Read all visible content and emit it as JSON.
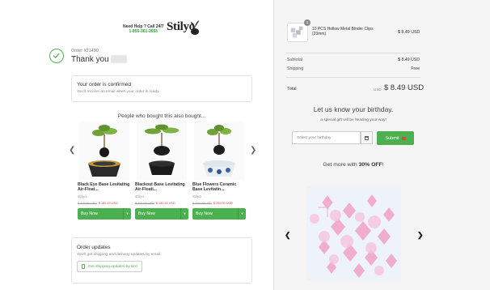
{
  "header": {
    "help_text": "Need Help ? Call 24/7",
    "phone": "1-855-361-2655",
    "logo": "Stilyo"
  },
  "order": {
    "number": "Order #21490",
    "thanks": "Thank you"
  },
  "confirmed": {
    "title": "Your order is confirmed",
    "subtitle": "You'll receive an email when your order is ready."
  },
  "upsell": {
    "title": "People who bought this also bought...",
    "products": [
      {
        "name": "Black Eye Base Levitating Air-Float...",
        "brand": "stilyo",
        "old_price": "$ 209.00 USD",
        "price": "$ 180.49 USD",
        "buy": "Buy Now"
      },
      {
        "name": "Blackout Base Levitating Air-Floati...",
        "brand": "stilyo",
        "old_price": "$ 209.00 USD",
        "price": "$ 180.49 USD",
        "buy": "Buy Now"
      },
      {
        "name": "Blue Flowers Ceramic Base Levitatin...",
        "brand": "stilyo",
        "old_price": "$ 209.00 USD",
        "price": "$ 209.00 USD",
        "buy": "Buy Now"
      }
    ]
  },
  "updates": {
    "title": "Order updates",
    "subtitle": "You'll get shipping and delivery updates by email.",
    "button": "Get shipping updates by text"
  },
  "cart": {
    "qty": "1",
    "item_name": "10 PCS Hollow Metal Binder Clips (20mm)",
    "item_price": "$ 8.49 USD",
    "subtotal_label": "Subtotal",
    "subtotal": "$ 8.49 USD",
    "shipping_label": "Shipping",
    "shipping": "Free",
    "total_label": "Total",
    "total_currency": "USD",
    "total": "$ 8.49 USD"
  },
  "birthday": {
    "title": "Let us know your birthday.",
    "subtitle": "a special gift will be heading your way!",
    "placeholder": "Select your birthday",
    "submit": "Submit"
  },
  "promo": {
    "text_pre": "Get more with",
    "highlight": "30% OFF",
    "text_post": "!"
  },
  "colors": {
    "accent_green": "#4caf50",
    "sale_red": "#e53935",
    "panel_bg": "#f5f5f5"
  }
}
